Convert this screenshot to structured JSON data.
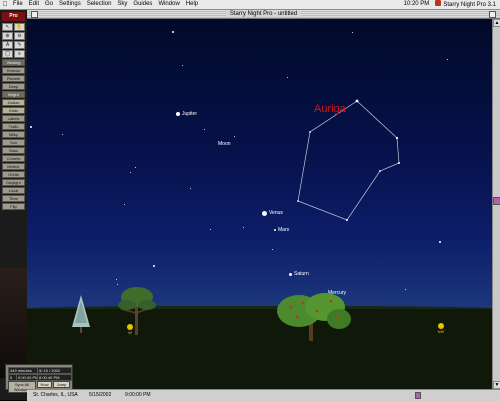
{
  "menubar": {
    "apple_icon": "apple-icon",
    "items": [
      "File",
      "Edit",
      "Go",
      "Settings",
      "Selection",
      "Sky",
      "Guides",
      "Window",
      "Help"
    ],
    "clock": "10:20 PM",
    "app_name": "Starry Night Pro 3.1"
  },
  "window": {
    "title": "Starry Night Pro - untitled"
  },
  "palette": {
    "logo": "Pro",
    "tools": [
      "↖",
      "✋",
      "⊕",
      "⊖",
      "A",
      "✎",
      "◯",
      "≡"
    ],
    "buttons": [
      "Viewing",
      "Horizon",
      "Planets",
      "Deep",
      "Bright",
      "Zodiac",
      "Grids",
      "Labels",
      "Trails",
      "Milky",
      "Sun",
      "Stars",
      "Comets",
      "Meteor",
      "Orbits",
      "Daylight",
      "Local",
      "Time",
      "Flip"
    ]
  },
  "sky": {
    "constellation": "Auriga",
    "planets": {
      "jupiter": "Jupiter",
      "moon": "Moon",
      "venus": "Venus",
      "mars": "Mars",
      "saturn": "Saturn",
      "mercury": "Mercury"
    },
    "compass": {
      "west": "W",
      "northwest": "NW"
    }
  },
  "timepanel": {
    "rate": "449 minutes",
    "date": "5/ 15 / 2002",
    "time": "8:00:40 PM",
    "offset": "0",
    "time2": "9:00:00 PM",
    "sync_label": "Sync All Windows",
    "now_label": "Now",
    "jump_label": "Jump"
  },
  "status": {
    "location": "St. Charles, IL, USA",
    "date": "5/15/2002",
    "time": "9:00:00 PM",
    "bottom_label": "Untitled"
  },
  "colors": {
    "constellation_label": "#d01818",
    "compass": "#e8c400",
    "scroll_thumb": "#b060b0"
  }
}
